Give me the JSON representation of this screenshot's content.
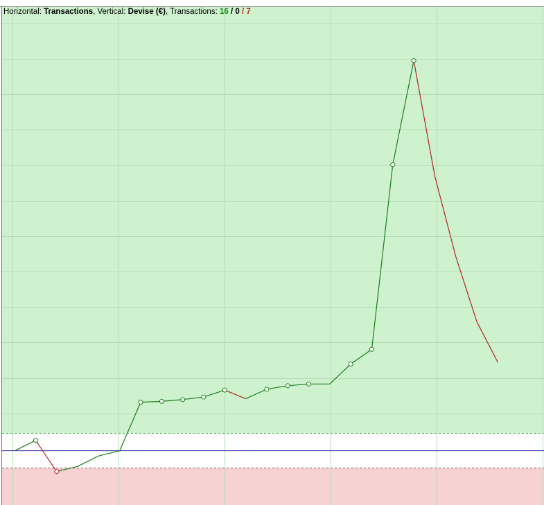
{
  "header": {
    "h_label": "Horizontal:",
    "h_value": "Transactions",
    "v_label": "Vertical:",
    "v_value": "Devise (€)",
    "t_label": "Transactions:",
    "wins": "16",
    "evens": "0",
    "losses": "7",
    "sep1": ", ",
    "sep2": ", ",
    "slash": " / "
  },
  "colors": {
    "win_line": "#1a7d1a",
    "loss_line": "#b22222",
    "profit_zone": "#cef2ce",
    "loss_zone": "#f6d2d2",
    "baseline": "#2a2aa0",
    "grid": "#b6dbb6",
    "marker_fill": "#ffffff"
  },
  "chart_data": {
    "type": "line",
    "title": "",
    "xlabel": "Transactions",
    "ylabel": "Devise (€)",
    "x": [
      0,
      1,
      2,
      3,
      4,
      5,
      6,
      7,
      8,
      9,
      10,
      11,
      12,
      13,
      14,
      15,
      16,
      17,
      18,
      19,
      20,
      21,
      22,
      23
    ],
    "y": [
      0.0,
      0.6,
      -1.2,
      -0.9,
      -0.3,
      0.0,
      2.8,
      2.85,
      2.95,
      3.1,
      3.5,
      3.0,
      3.55,
      3.75,
      3.85,
      3.85,
      5.0,
      5.85,
      16.5,
      22.5,
      15.85,
      11.2,
      7.45,
      5.1
    ],
    "ylim": [
      -3.13,
      25.6
    ],
    "xlim": [
      -0.6,
      25.2
    ],
    "baseline": 0,
    "bands": {
      "upper_threshold": 1.0,
      "lower_threshold": -1.0
    },
    "markers": [
      1,
      2,
      6,
      7,
      8,
      9,
      10,
      12,
      13,
      14,
      16,
      17,
      18,
      19
    ],
    "grid": true
  }
}
